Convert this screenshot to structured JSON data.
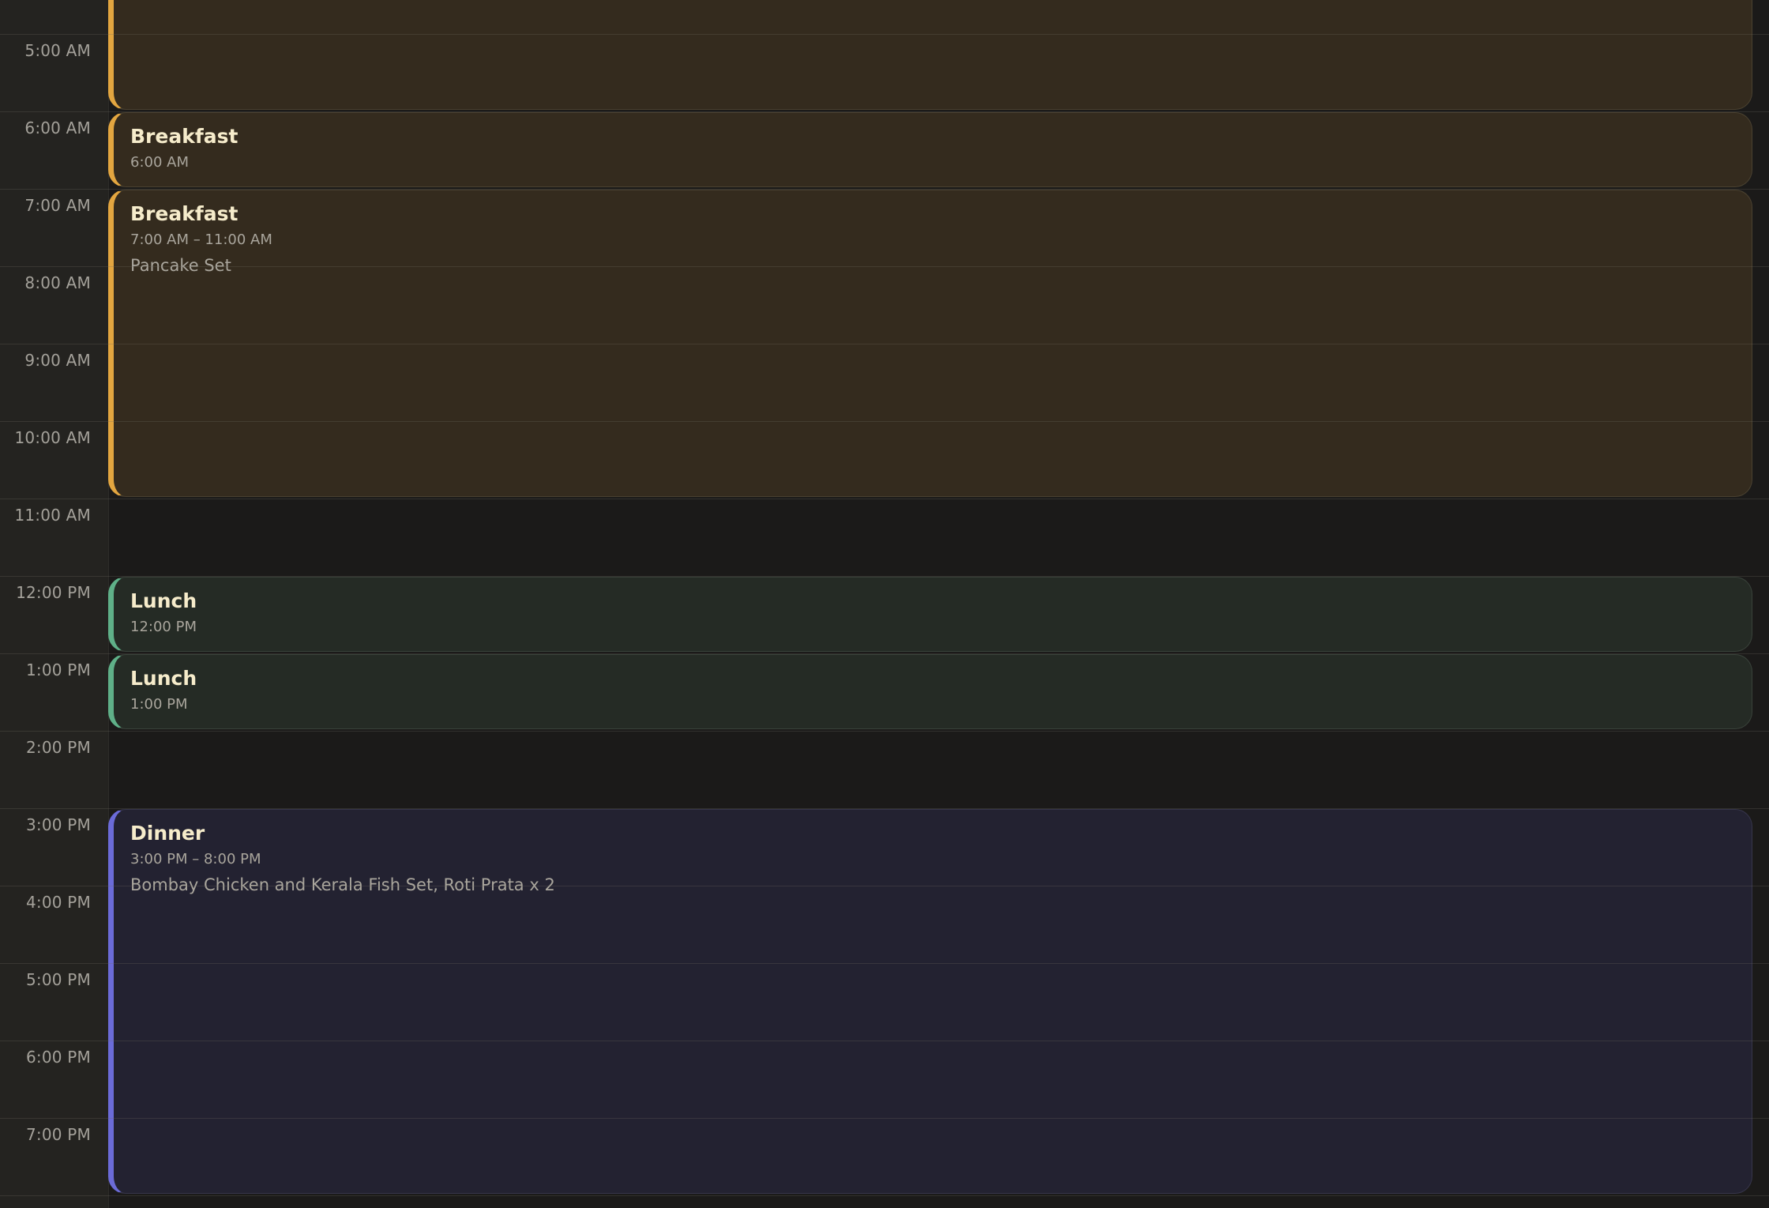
{
  "time_labels": [
    "5:00 AM",
    "6:00 AM",
    "7:00 AM",
    "8:00 AM",
    "9:00 AM",
    "10:00 AM",
    "11:00 AM",
    "12:00 PM",
    "1:00 PM",
    "2:00 PM",
    "3:00 PM",
    "4:00 PM",
    "5:00 PM",
    "6:00 PM",
    "7:00 PM"
  ],
  "events": [
    {
      "category": "breakfast",
      "title": "",
      "time": "",
      "description": ""
    },
    {
      "category": "breakfast",
      "title": "Breakfast",
      "time": "6:00 AM",
      "description": ""
    },
    {
      "category": "breakfast",
      "title": "Breakfast",
      "time": "7:00 AM – 11:00 AM",
      "description": "Pancake Set"
    },
    {
      "category": "lunch",
      "title": "Lunch",
      "time": "12:00 PM",
      "description": ""
    },
    {
      "category": "lunch",
      "title": "Lunch",
      "time": "1:00 PM",
      "description": ""
    },
    {
      "category": "dinner",
      "title": "Dinner",
      "time": "3:00 PM – 8:00 PM",
      "description": "Bombay Chicken and Kerala Fish Set, Roti Prata x 2"
    }
  ],
  "colors": {
    "breakfast_accent": "#e3a640",
    "lunch_accent": "#5fb088",
    "dinner_accent": "#6b6bd8",
    "event_title": "#f6eccb"
  }
}
